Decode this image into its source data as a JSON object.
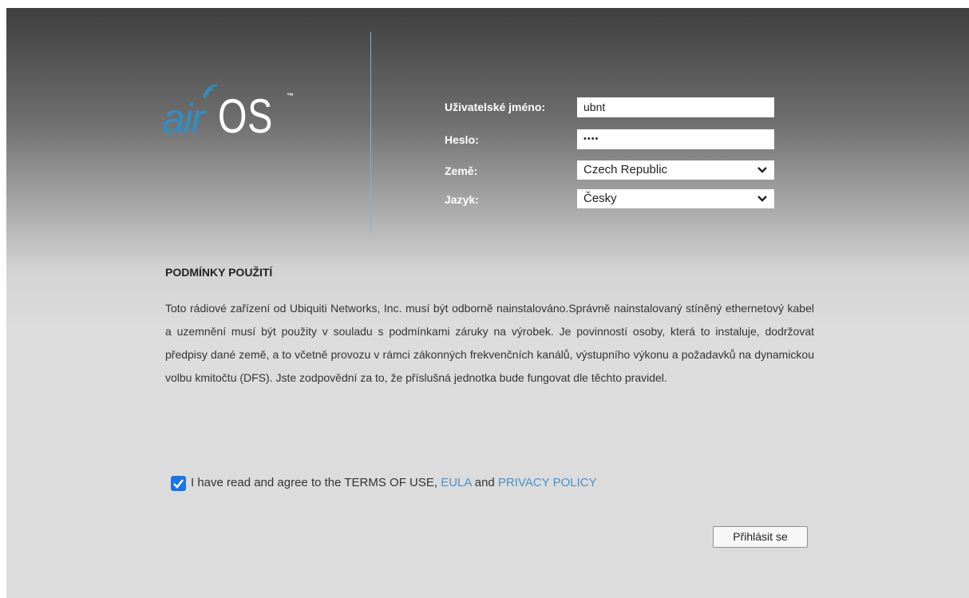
{
  "logo": {
    "air": "air",
    "os": "OS",
    "tm": "™"
  },
  "login": {
    "username_label": "Uživatelské jméno:",
    "username_value": "ubnt",
    "password_label": "Heslo:",
    "password_mask": "••••",
    "country_label": "Země:",
    "country_value": "Czech Republic",
    "language_label": "Jazyk:",
    "language_value": "Česky"
  },
  "terms": {
    "title": "PODMÍNKY POUŽITÍ",
    "body": "Toto rádiové zařízení od Ubiquiti Networks, Inc. musí být odborně nainstalováno.Správně nainstalovaný stíněný ethernetový kabel a uzemnění musí být použity v souladu s podmínkami záruky na výrobek. Je povinností osoby, která to instaluje, dodržovat předpisy dané země, a to včetně provozu v rámci zákonných frekvenčních kanálů, výstupního výkonu a požadavků na dynamickou volbu kmitočtu (DFS). Jste zodpovědní za to, že příslušná jednotka bude fungovat dle těchto pravidel.",
    "agree_prefix": "I have read and agree to the TERMS OF USE, ",
    "eula_link": "EULA",
    "and_text": " and ",
    "privacy_link": "PRIVACY POLICY",
    "checked": true
  },
  "actions": {
    "login_label": "Přihlásit se"
  },
  "colors": {
    "accent": "#2f8fc6",
    "link": "#4a90c8",
    "checkbox": "#1a73e8"
  }
}
